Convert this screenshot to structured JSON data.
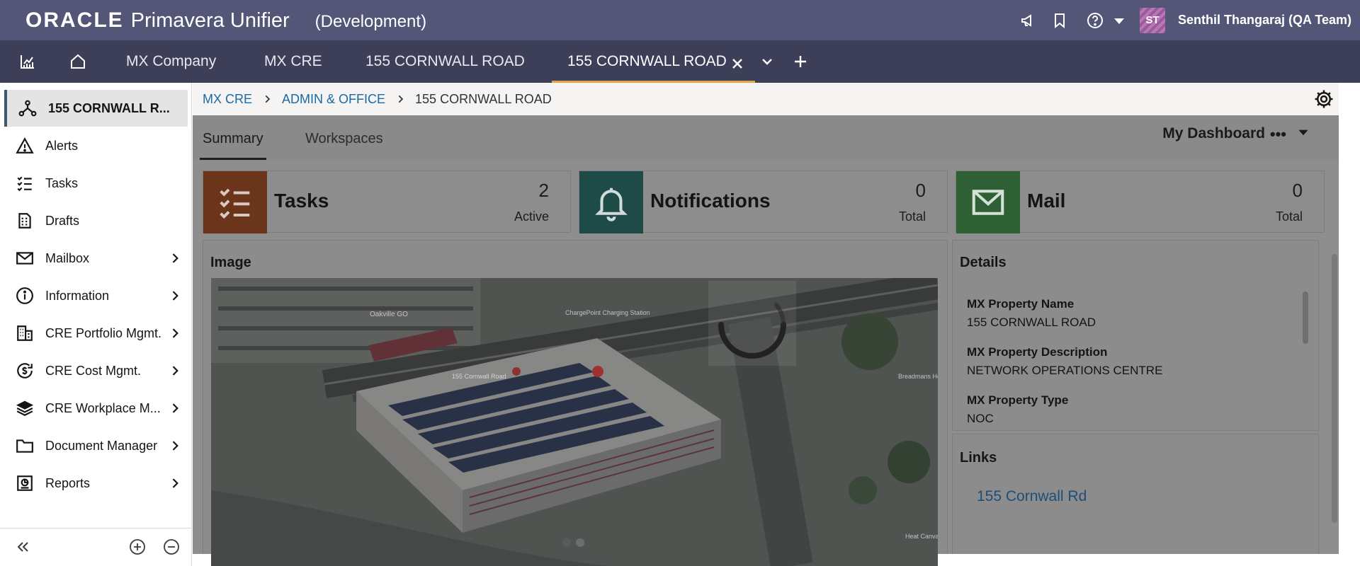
{
  "header": {
    "brand_oracle": "ORACLE",
    "brand_product": "Primavera Unifier",
    "environment": "(Development)",
    "user_initials": "ST",
    "user_name": "Senthil Thangaraj (QA Team)"
  },
  "tabs": {
    "items": [
      {
        "label": "MX Company"
      },
      {
        "label": "MX CRE"
      },
      {
        "label": "155 CORNWALL ROAD"
      },
      {
        "label": "155 CORNWALL ROAD"
      }
    ]
  },
  "sidebar": {
    "items": [
      {
        "label": "155 CORNWALL R...",
        "icon": "project-tree-icon"
      },
      {
        "label": "Alerts",
        "icon": "alert-icon"
      },
      {
        "label": "Tasks",
        "icon": "tasks-icon"
      },
      {
        "label": "Drafts",
        "icon": "drafts-icon"
      },
      {
        "label": "Mailbox",
        "icon": "mailbox-icon"
      },
      {
        "label": "Information",
        "icon": "information-icon"
      },
      {
        "label": "CRE Portfolio Mgmt.",
        "icon": "building-icon"
      },
      {
        "label": "CRE Cost Mgmt.",
        "icon": "cost-icon"
      },
      {
        "label": "CRE Workplace M...",
        "icon": "layers-icon"
      },
      {
        "label": "Document Manager",
        "icon": "folder-icon"
      },
      {
        "label": "Reports",
        "icon": "reports-icon"
      }
    ]
  },
  "breadcrumb": {
    "items": [
      "MX CRE",
      "ADMIN & OFFICE",
      "155 CORNWALL ROAD"
    ]
  },
  "main": {
    "tabs": [
      "Summary",
      "Workspaces"
    ],
    "dashboard_name": "My Dashboard",
    "dashboard_more": "•••"
  },
  "tiles": [
    {
      "title": "Tasks",
      "count": "2",
      "sub": "Active",
      "color": "#6b351c"
    },
    {
      "title": "Notifications",
      "count": "0",
      "sub": "Total",
      "color": "#1e4a47"
    },
    {
      "title": "Mail",
      "count": "0",
      "sub": "Total",
      "color": "#2f5f34"
    }
  ],
  "image_panel": {
    "title": "Image",
    "map_labels": [
      "Oakville GO",
      "ChargePoint Charging Station",
      "155 Cornwall Road",
      "Breadmans House",
      "Heat Canvas"
    ]
  },
  "details_panel": {
    "title": "Details",
    "fields": [
      {
        "label": "MX Property Name",
        "value": "155 CORNWALL ROAD"
      },
      {
        "label": "MX Property Description",
        "value": "NETWORK OPERATIONS CENTRE"
      },
      {
        "label": "MX Property Type",
        "value": "NOC"
      }
    ]
  },
  "links_panel": {
    "title": "Links",
    "items": [
      "155 Cornwall Rd"
    ]
  },
  "colors": {
    "header_bg": "#545677",
    "tabbar_bg": "#3d3f58",
    "active_tab_underline": "#e6a34a",
    "link": "#1a6aa6"
  }
}
